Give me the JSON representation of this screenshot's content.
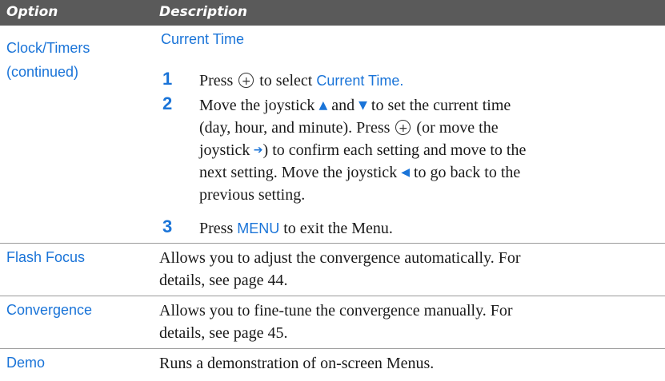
{
  "header": {
    "option": "Option",
    "description": "Description"
  },
  "clock": {
    "option_line1": "Clock/Timers",
    "option_line2": "(continued)",
    "subheading": "Current Time",
    "steps": [
      {
        "num": "1",
        "l1a": "Press",
        "l1b": "to select",
        "l1c": "Current Time."
      },
      {
        "num": "2",
        "l1a": "Move the joystick",
        "l1b": "and",
        "l1c": "to set the current time",
        "l2": "(day, hour, and minute). Press",
        "l2b": "(or move the",
        "l3a": "joystick",
        "l3b": ") to confirm each setting and move to the",
        "l4a": "next setting. Move the joystick",
        "l4b": "to go back to the",
        "l5": "previous setting."
      },
      {
        "num": "3",
        "l1a": "Press",
        "l1b": "MENU",
        "l1c": "to exit the Menu."
      }
    ]
  },
  "rows": {
    "flash": {
      "option": "Flash Focus",
      "l1": "Allows you to adjust the convergence automatically. For",
      "l2": "details, see page 44."
    },
    "conv": {
      "option": "Convergence",
      "l1": "Allows you to fine-tune the convergence manually. For",
      "l2": "details, see page 45."
    },
    "demo": {
      "option": "Demo",
      "l1": "Runs a demonstration of on-screen Menus."
    }
  },
  "icons": {
    "up": "arrow-up-icon",
    "down": "arrow-down-icon",
    "right": "arrow-right-icon",
    "left": "arrow-left-icon",
    "select": "joystick-press-icon"
  }
}
